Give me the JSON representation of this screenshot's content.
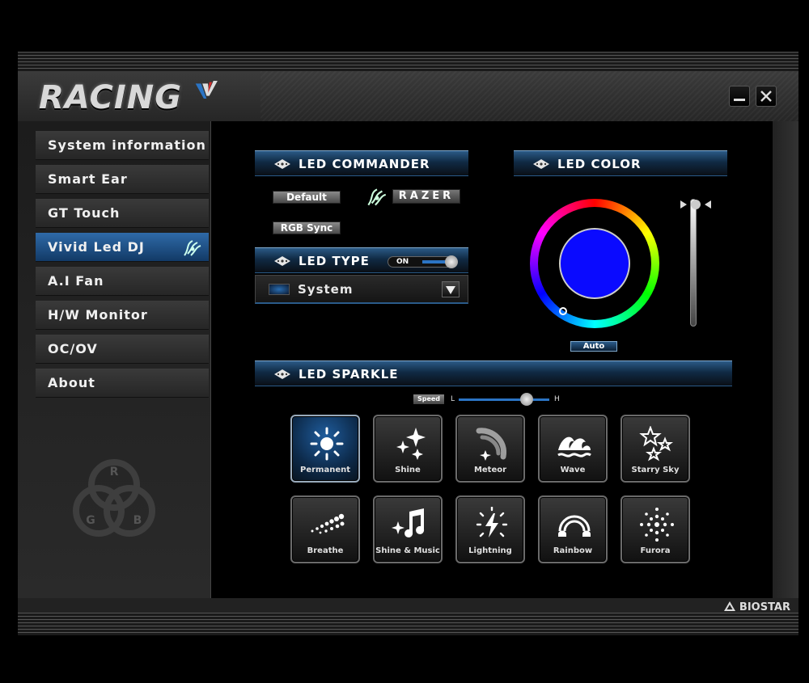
{
  "app": {
    "logo_text": "RACING"
  },
  "sidebar": {
    "items": [
      {
        "label": "System information"
      },
      {
        "label": "Smart Ear"
      },
      {
        "label": "GT Touch"
      },
      {
        "label": "Vivid Led DJ"
      },
      {
        "label": "A.I Fan"
      },
      {
        "label": "H/W Monitor"
      },
      {
        "label": "OC/OV"
      },
      {
        "label": "About"
      }
    ],
    "active_index": 3,
    "rgb_logo": {
      "r": "R",
      "g": "G",
      "b": "B"
    }
  },
  "led_commander": {
    "title": "LED COMMANDER",
    "default_label": "Default",
    "razer_label": "RAZER",
    "rgb_sync_label": "RGB Sync"
  },
  "led_type": {
    "title": "LED TYPE",
    "toggle_label": "ON",
    "toggle_state": true,
    "selected": "System"
  },
  "led_color": {
    "title": "LED COLOR",
    "current_color": "#0a0aff",
    "auto_label": "Auto",
    "brightness": 1.0
  },
  "led_sparkle": {
    "title": "LED SPARKLE",
    "speed_tag": "Speed",
    "speed_low": "L",
    "speed_high": "H",
    "speed_value": 0.75,
    "effects": [
      {
        "label": "Permanent",
        "icon": "sun-icon",
        "active": true
      },
      {
        "label": "Shine",
        "icon": "sparkle-icon",
        "active": false
      },
      {
        "label": "Meteor",
        "icon": "meteor-icon",
        "active": false
      },
      {
        "label": "Wave",
        "icon": "wave-icon",
        "active": false
      },
      {
        "label": "Starry Sky",
        "icon": "stars-icon",
        "active": false
      },
      {
        "label": "Breathe",
        "icon": "breathe-icon",
        "active": false
      },
      {
        "label": "Shine & Music",
        "icon": "music-icon",
        "active": false
      },
      {
        "label": "Lightning",
        "icon": "lightning-icon",
        "active": false
      },
      {
        "label": "Rainbow",
        "icon": "rainbow-icon",
        "active": false
      },
      {
        "label": "Furora",
        "icon": "aurora-icon",
        "active": false
      }
    ]
  },
  "footer": {
    "brand": "BIOSTAR"
  },
  "colors": {
    "accent": "#2b74c4",
    "active_nav": "#2f6aa8"
  }
}
